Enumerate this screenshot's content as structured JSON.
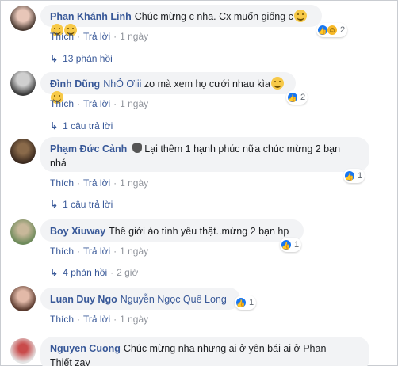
{
  "comments": [
    {
      "author": "Phan Khánh Linh",
      "text": "Chúc mừng c nha. Cx muốn giống c",
      "actions": {
        "like": "Thích",
        "reply": "Trả lời",
        "time": "1 ngày"
      },
      "reaction_count": "2",
      "replies": "13 phản hồi",
      "avatar_colors": [
        "#e8c6b8",
        "#4a3b33"
      ]
    },
    {
      "author": "Đình Dũng",
      "tag": "NhỎ Ơiii",
      "text": "zo mà xem họ cưới nhau kìa",
      "actions": {
        "like": "Thích",
        "reply": "Trả lời",
        "time": "1 ngày"
      },
      "reaction_count": "2",
      "replies": "1 câu trả lời",
      "avatar_colors": [
        "#d9d9d9",
        "#3a3a3a"
      ]
    },
    {
      "author": "Phạm Đức Cảnh",
      "text": "Lại thêm 1 hạnh phúc nữa chúc mừng 2 bạn",
      "text2": "nhá",
      "actions": {
        "like": "Thích",
        "reply": "Trả lời",
        "time": "1 ngày"
      },
      "reaction_count": "1",
      "replies": "1 câu trả lời",
      "avatar_colors": [
        "#3b2a1f",
        "#8a6a4a"
      ]
    },
    {
      "author": "Boy Xiuway",
      "text": "Thế giới ảo tình yêu thật..mừng 2 bạn hp",
      "actions": {
        "like": "Thích",
        "reply": "Trả lời",
        "time": "1 ngày"
      },
      "reaction_count": "1",
      "replies": "4 phản hồi",
      "replies_time": "2 giờ",
      "avatar_colors": [
        "#6d8a5a",
        "#c8b89a"
      ]
    },
    {
      "author": "Luan Duy Ngo",
      "tag": "Nguyễn Ngọc Quế Long",
      "text": "",
      "actions": {
        "like": "Thích",
        "reply": "Trả lời",
        "time": "1 ngày"
      },
      "reaction_count": "1",
      "avatar_colors": [
        "#e2b9a8",
        "#5a3a2e"
      ]
    },
    {
      "author": "Nguyen Cuong",
      "text": "Chúc mừng nha nhưng ai ở yên bái ai ở Phan",
      "text2": "Thiết zay",
      "avatar_colors": [
        "#e5e5e5",
        "#c94b4b"
      ]
    }
  ],
  "colors": {
    "link": "#385898",
    "bubble": "#f2f3f5",
    "like": "#1877f2"
  }
}
